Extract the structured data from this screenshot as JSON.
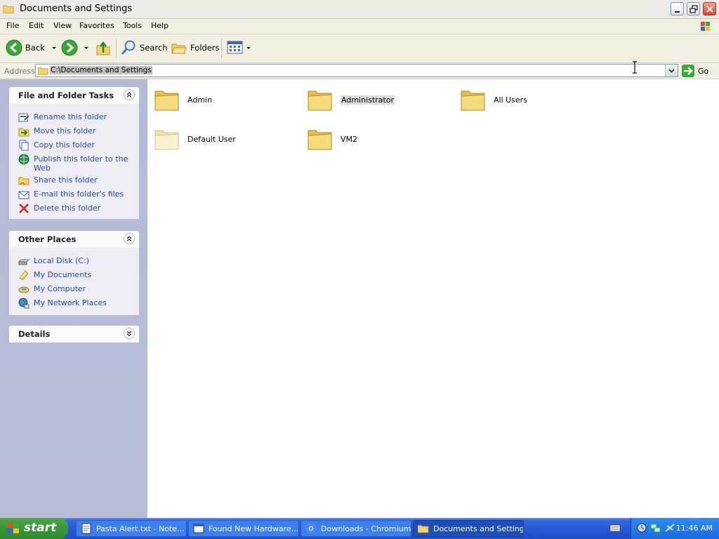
{
  "window": {
    "title": "Documents and Settings",
    "icon": "folder-icon"
  },
  "menubar": {
    "items": [
      "File",
      "Edit",
      "View",
      "Favorites",
      "Tools",
      "Help"
    ]
  },
  "toolbar": {
    "back_label": "Back",
    "search_label": "Search",
    "folders_label": "Folders"
  },
  "addressbar": {
    "label": "Address",
    "value": "C:\\Documents and Settings",
    "go_label": "Go"
  },
  "taskpane": {
    "file_tasks": {
      "title": "File and Folder Tasks",
      "items": [
        {
          "label": "Rename this folder",
          "icon": "rename-icon"
        },
        {
          "label": "Move this folder",
          "icon": "move-icon"
        },
        {
          "label": "Copy this folder",
          "icon": "copy-icon"
        },
        {
          "label": "Publish this folder to the Web",
          "icon": "publish-web-icon"
        },
        {
          "label": "Share this folder",
          "icon": "share-icon"
        },
        {
          "label": "E-mail this folder's files",
          "icon": "email-icon"
        },
        {
          "label": "Delete this folder",
          "icon": "delete-icon"
        }
      ]
    },
    "other_places": {
      "title": "Other Places",
      "items": [
        {
          "label": "Local Disk (C:)",
          "icon": "disk-icon"
        },
        {
          "label": "My Documents",
          "icon": "my-documents-icon"
        },
        {
          "label": "My Computer",
          "icon": "my-computer-icon"
        },
        {
          "label": "My Network Places",
          "icon": "network-places-icon"
        }
      ]
    },
    "details": {
      "title": "Details"
    }
  },
  "files": [
    {
      "name": "Admin",
      "selected": false,
      "faded": false
    },
    {
      "name": "Administrator",
      "selected": true,
      "faded": false
    },
    {
      "name": "All Users",
      "selected": false,
      "faded": false
    },
    {
      "name": "Default User",
      "selected": false,
      "faded": true
    },
    {
      "name": "VM2",
      "selected": false,
      "faded": false
    }
  ],
  "taskbar": {
    "start_label": "start",
    "apps": [
      {
        "label": "Pasta Alert.txt - Note...",
        "icon": "notepad-icon",
        "active": false
      },
      {
        "label": "Found New Hardware...",
        "icon": "window-icon",
        "active": false
      },
      {
        "label": "Downloads - Chromium",
        "icon": "chromium-icon",
        "active": false
      },
      {
        "label": "Documents and Settings",
        "icon": "folder-icon",
        "active": true
      }
    ],
    "clock": "11:46 AM"
  },
  "colors": {
    "task_link": "#254aa8",
    "taskbar_blue": "#2456d6",
    "start_green": "#3b9a39",
    "folder_yellow": "#f5d76e"
  }
}
